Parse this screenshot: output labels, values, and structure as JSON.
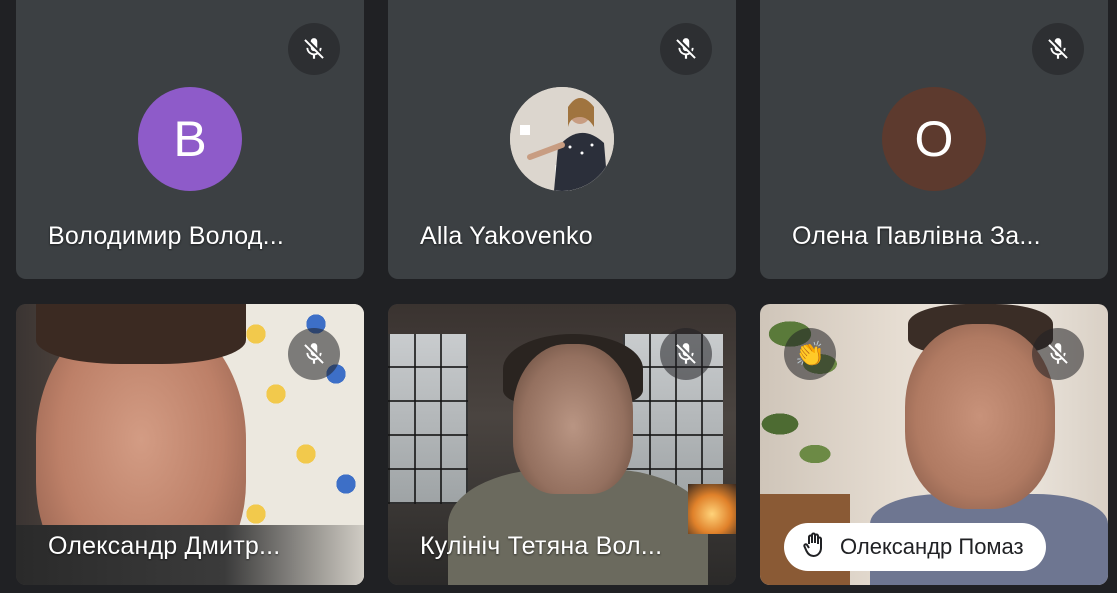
{
  "participants": [
    {
      "name": "Володимир Волод...",
      "avatar_letter": "B",
      "avatar_color": "#8e5bc9",
      "muted": true
    },
    {
      "name": "Alla Yakovenko",
      "avatar_letter": "",
      "avatar_color": "#8a7f76",
      "muted": true
    },
    {
      "name": "Олена Павлівна За...",
      "avatar_letter": "O",
      "avatar_color": "#5d3a2e",
      "muted": true
    },
    {
      "name": "Олександр Дмитр...",
      "muted": true
    },
    {
      "name": "Кулініч Тетяна Вол...",
      "muted": true
    },
    {
      "name": "Олександр Помаз",
      "muted": true,
      "hand_raised": true,
      "reaction_icon": "clapping-hands-icon"
    }
  ],
  "icons": {
    "mute": "mic-off-icon",
    "raised_hand": "raised-hand-icon"
  },
  "colors": {
    "background": "#202124",
    "tile": "#3c4043"
  }
}
